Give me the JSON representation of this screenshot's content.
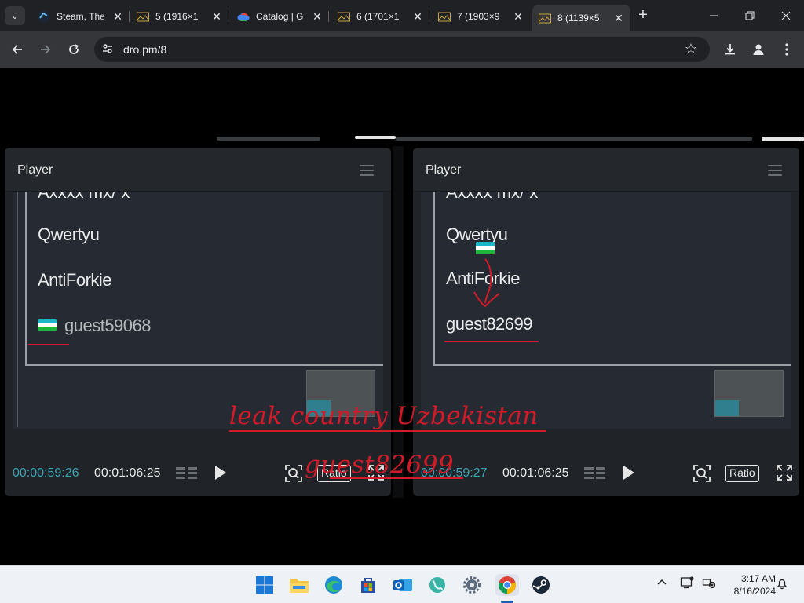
{
  "browser": {
    "tabs": [
      {
        "label": "Steam, The",
        "icon": "steam-icon"
      },
      {
        "label": "5 (1916×1",
        "icon": "image-folder-icon"
      },
      {
        "label": "Catalog | G",
        "icon": "google-cloud-icon"
      },
      {
        "label": "6 (1701×1",
        "icon": "image-folder-icon"
      },
      {
        "label": "7 (1903×9",
        "icon": "image-folder-icon"
      },
      {
        "label": "8 (1139×5",
        "icon": "image-folder-icon",
        "active": true
      }
    ],
    "url": "dro.pm/8"
  },
  "players": [
    {
      "title": "Player",
      "names": [
        "Qwertyu",
        "AntiForkie",
        "guest59068"
      ],
      "current_time": "00:00:59:26",
      "total_time": "00:01:06:25",
      "ratio_label": "Ratio"
    },
    {
      "title": "Player",
      "names": [
        "Qwertyu",
        "AntiForkie",
        "guest82699"
      ],
      "current_time": "00:00:59:27",
      "total_time": "00:01:06:25",
      "ratio_label": "Ratio"
    }
  ],
  "annotation": {
    "line1": "leak country Uzbekistan",
    "line2": "guest82699",
    "color": "#d21a28"
  },
  "flag_colors": [
    "#1eb5c9",
    "#ffffff",
    "#1eb53a"
  ],
  "taskbar": {
    "apps": [
      "windows-start-icon",
      "file-explorer-icon",
      "edge-icon",
      "microsoft-store-icon",
      "outlook-icon",
      "maps-icon",
      "settings-icon",
      "chrome-icon",
      "steam-icon"
    ],
    "time": "3:17 AM",
    "date": "8/16/2024"
  }
}
